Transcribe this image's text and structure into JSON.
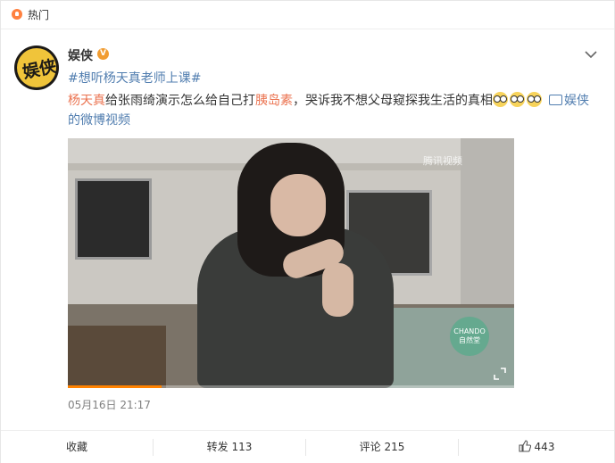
{
  "hot_bar": {
    "label": "热门",
    "icon": "hot-flame-icon"
  },
  "author": {
    "name": "娱侠",
    "avatar_text": "娱侠",
    "verified_badge": "V"
  },
  "post": {
    "topic": "#想听杨天真老师上课#",
    "text_prefix_link": "杨天真",
    "text_part1": "给张雨绮演示怎么给自己打",
    "text_link2": "胰岛素",
    "text_part2": "，哭诉我不想父母窥探我生活的真相",
    "emoji_count": 3,
    "video_link_part1": "娱侠",
    "video_link_part2": "的微博视频",
    "timestamp": "05月16日 21:17"
  },
  "video": {
    "watermark": "腾讯视频",
    "badge_line1": "CHANDO",
    "badge_line2": "自然堂",
    "progress": 0.21
  },
  "actions": {
    "favorite": "收藏",
    "repost": "转发 113",
    "comment": "评论 215",
    "like": "443"
  },
  "colors": {
    "link_orange": "#eb7350",
    "link_blue": "#507daf",
    "hot_orange": "#ff8140",
    "verified": "#f19c31"
  }
}
